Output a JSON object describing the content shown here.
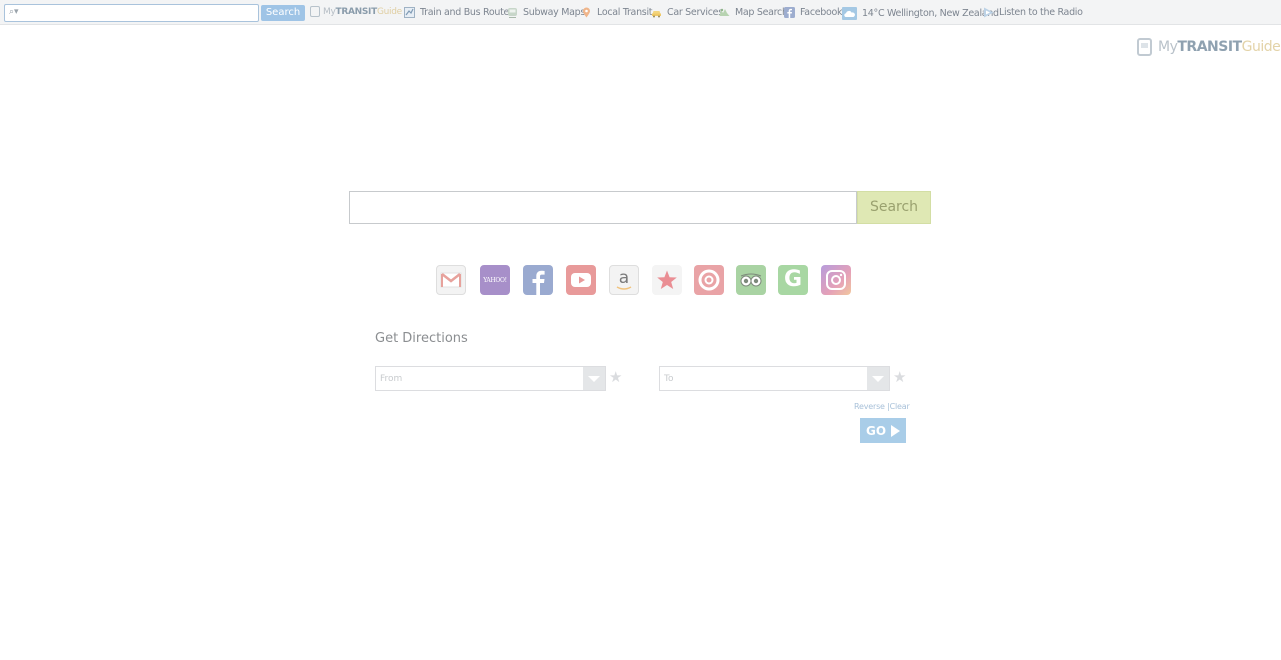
{
  "toolbar": {
    "search_placeholder": "",
    "search_button": "Search",
    "brand": {
      "my": "My",
      "transit": "TRANSIT",
      "guide": "Guide"
    },
    "links": [
      {
        "label": "Train and Bus Routes",
        "icon": "route-map-icon"
      },
      {
        "label": "Subway Maps",
        "icon": "subway-icon"
      },
      {
        "label": "Local Transit",
        "icon": "map-pin-icon"
      },
      {
        "label": "Car Services",
        "icon": "taxi-icon"
      },
      {
        "label": "Map Search",
        "icon": "map-search-icon"
      },
      {
        "label": "Facebook",
        "icon": "facebook-icon"
      },
      {
        "label": "14°C Wellington, New Zealand",
        "icon": "weather-cloud-icon"
      },
      {
        "label": "Listen to the Radio",
        "icon": "play-icon"
      }
    ]
  },
  "corner_logo": {
    "my": "My",
    "transit": "TRANSIT",
    "guide": "Guide",
    "tm": "™"
  },
  "main_search": {
    "placeholder": "",
    "button": "Search"
  },
  "quick_links": [
    {
      "name": "gmail",
      "icon": "gmail-icon",
      "color": "#f3f3f3"
    },
    {
      "name": "yahoo",
      "icon": "yahoo-icon",
      "color": "#a78fc9",
      "text": "YAHOO!"
    },
    {
      "name": "facebook",
      "icon": "facebook-icon",
      "color": "#9aaad0"
    },
    {
      "name": "youtube",
      "icon": "youtube-icon",
      "color": "#e89a9a"
    },
    {
      "name": "amazon",
      "icon": "amazon-icon",
      "color": "#f3f3f3",
      "text": "a"
    },
    {
      "name": "favorites",
      "icon": "star-icon",
      "color": "#f4f4f4"
    },
    {
      "name": "target",
      "icon": "target-icon",
      "color": "#e9a3a6"
    },
    {
      "name": "tripadvisor",
      "icon": "tripadvisor-icon",
      "color": "#a9d3a3"
    },
    {
      "name": "grammarly",
      "icon": "grammarly-icon",
      "color": "#a8d7a3",
      "text": "G"
    },
    {
      "name": "instagram",
      "icon": "instagram-icon",
      "color": "#c79bd6"
    }
  ],
  "directions": {
    "title": "Get Directions",
    "from_placeholder": "From",
    "to_placeholder": "To",
    "reverse": "Reverse",
    "separator": " |",
    "clear": "Clear",
    "go": "GO"
  }
}
